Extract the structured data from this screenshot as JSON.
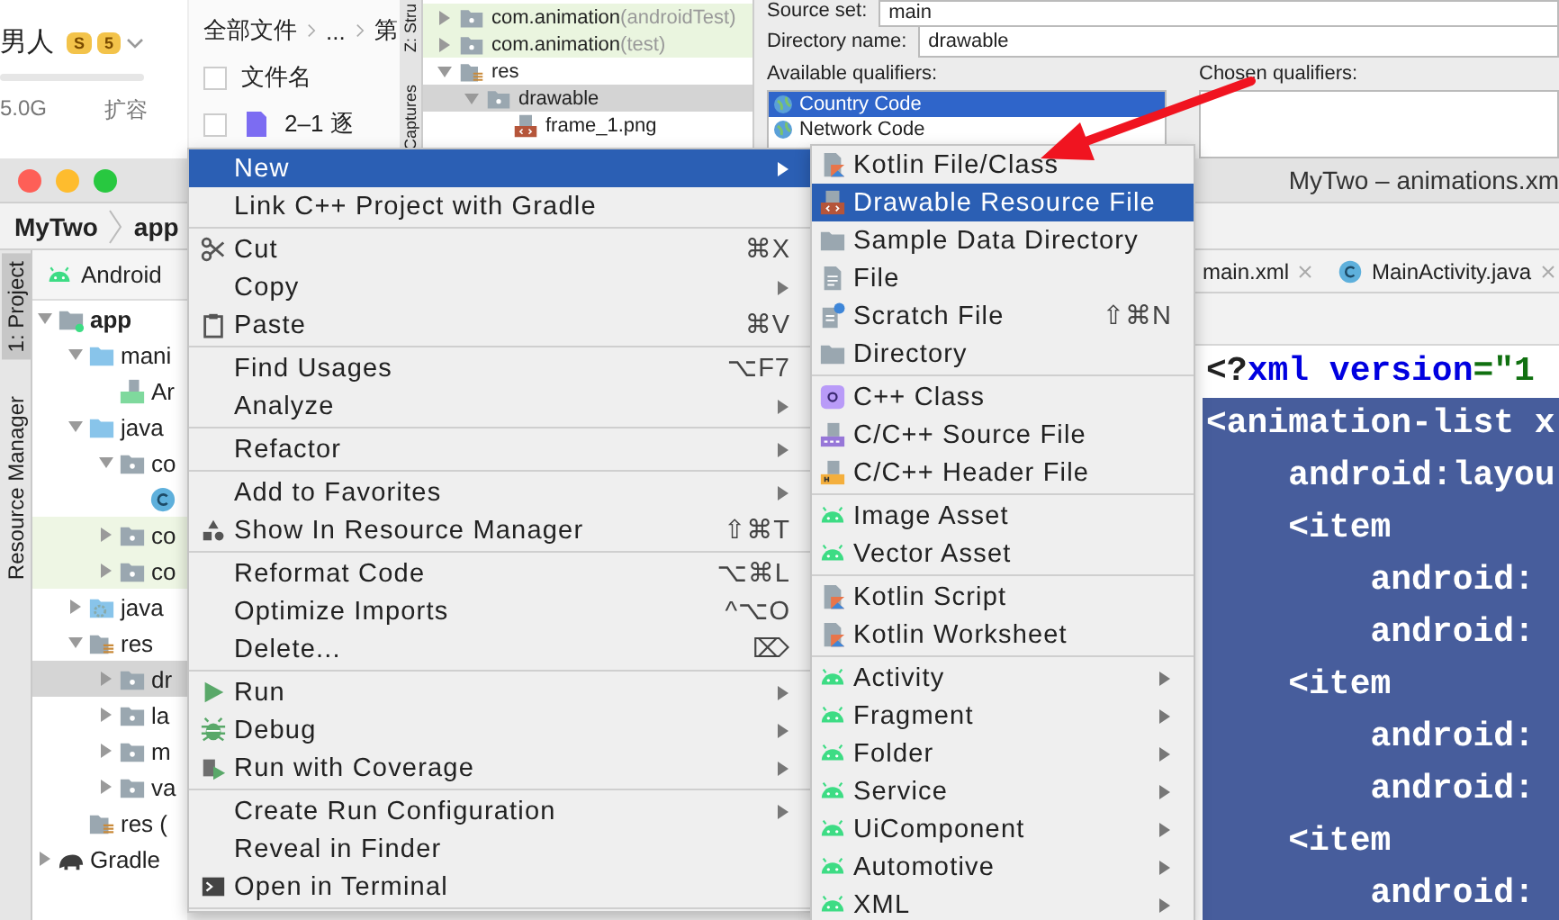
{
  "file_manager": {
    "user_name": "男人",
    "badges": [
      "S",
      "5"
    ],
    "storage": "5.0G",
    "expand_label": "扩容",
    "breadcrumb": [
      "全部文件",
      "...",
      "第"
    ],
    "column_header": "文件名",
    "header_checked": false,
    "rows": [
      {
        "name": "2–1 逐",
        "checked": false
      }
    ]
  },
  "structure_window": {
    "side_tabs": [
      "Z: Stru",
      "Captures"
    ],
    "tree": [
      {
        "label": "com.animation",
        "note": "(androidTest)",
        "expanded": false,
        "selected": false,
        "highlighted": true
      },
      {
        "label": "com.animation",
        "note": "(test)",
        "expanded": false,
        "selected": false,
        "highlighted": true
      },
      {
        "label": "res",
        "expanded": true,
        "selected": false,
        "highlighted": false,
        "children": [
          {
            "label": "drawable",
            "expanded": true,
            "selected": true,
            "children": [
              {
                "label": "frame_1.png",
                "selected": false,
                "highlighted": false
              }
            ]
          }
        ]
      }
    ]
  },
  "new_resource_dialog": {
    "source_set_label": "Source set:",
    "source_set": "main",
    "directory_name_label": "Directory name:",
    "directory_name": "drawable",
    "available_label": "Available qualifiers:",
    "available_qualifiers": [
      {
        "label": "Country Code",
        "selected": true
      },
      {
        "label": "Network Code",
        "selected": false
      }
    ],
    "chosen_label": "Chosen qualifiers:"
  },
  "ide": {
    "window_title": "MyTwo – animations.xm",
    "breadcrumb": [
      "MyTwo",
      "app"
    ],
    "side_tabs": [
      {
        "label": "1: Project",
        "selected": true
      },
      {
        "label": "Resource Manager",
        "selected": false
      }
    ],
    "project_view": "Android",
    "project_tree": [
      {
        "label": "app",
        "expanded": true,
        "selected": false,
        "highlighted": false,
        "children": [
          {
            "label": "mani",
            "expanded": true,
            "selected": false,
            "highlighted": false,
            "children": [
              {
                "label": "Ar",
                "selected": false,
                "highlighted": false
              }
            ]
          },
          {
            "label": "java",
            "expanded": true,
            "selected": false,
            "highlighted": false,
            "children": [
              {
                "label": "co",
                "expanded": true,
                "selected": false,
                "highlighted": false,
                "children": [
                  {
                    "selected": false,
                    "highlighted": false
                  }
                ]
              },
              {
                "label": "co",
                "expanded": false,
                "selected": false,
                "highlighted": true
              },
              {
                "label": "co",
                "expanded": false,
                "selected": false,
                "highlighted": true
              }
            ]
          },
          {
            "label": "java",
            "expanded": false,
            "selected": false,
            "highlighted": false
          },
          {
            "label": "res",
            "expanded": true,
            "selected": false,
            "highlighted": false,
            "children": [
              {
                "label": "dr",
                "expanded": false,
                "selected": true
              },
              {
                "label": "la",
                "expanded": false,
                "selected": false,
                "highlighted": false
              },
              {
                "label": "m",
                "expanded": false,
                "selected": false,
                "highlighted": false
              },
              {
                "label": "va",
                "expanded": false,
                "selected": false,
                "highlighted": false
              }
            ]
          },
          {
            "label": "res (",
            "selected": false,
            "highlighted": false
          }
        ]
      },
      {
        "label": "Gradle",
        "expanded": false,
        "selected": false,
        "highlighted": false
      }
    ],
    "editor_tabs": [
      {
        "label": "main.xml"
      },
      {
        "label": "MainActivity.java"
      }
    ],
    "code_lines": [
      {
        "selected": false,
        "tokens": [
          {
            "text": "<?",
            "kind": "plain"
          },
          {
            "text": "xml version",
            "kind": "keyword"
          },
          {
            "text": "=\"1",
            "kind": "string"
          }
        ]
      },
      {
        "selected": true,
        "tokens": [
          {
            "text": "<animation-list x",
            "kind": "plain"
          }
        ]
      },
      {
        "selected": true,
        "tokens": [
          {
            "text": "    android:layou",
            "kind": "plain"
          }
        ]
      },
      {
        "selected": true,
        "tokens": [
          {
            "text": "    <item",
            "kind": "plain"
          }
        ]
      },
      {
        "selected": true,
        "tokens": [
          {
            "text": "        android:",
            "kind": "plain"
          }
        ]
      },
      {
        "selected": true,
        "tokens": [
          {
            "text": "        android:",
            "kind": "plain"
          }
        ]
      },
      {
        "selected": true,
        "tokens": [
          {
            "text": "    <item",
            "kind": "plain"
          }
        ]
      },
      {
        "selected": true,
        "tokens": [
          {
            "text": "        android:",
            "kind": "plain"
          }
        ]
      },
      {
        "selected": true,
        "tokens": [
          {
            "text": "        android:",
            "kind": "plain"
          }
        ]
      },
      {
        "selected": true,
        "tokens": [
          {
            "text": "    <item",
            "kind": "plain"
          }
        ]
      },
      {
        "selected": true,
        "tokens": [
          {
            "text": "        android:",
            "kind": "plain"
          }
        ]
      }
    ]
  },
  "context_menu": {
    "items": [
      {
        "kind": "item",
        "label": "New",
        "submenu": true,
        "selected": true
      },
      {
        "kind": "item",
        "label": "Link C++ Project with Gradle",
        "submenu": false,
        "selected": false
      },
      {
        "kind": "separator"
      },
      {
        "kind": "item",
        "label": "Cut",
        "shortcut": "⌘X",
        "submenu": false,
        "selected": false
      },
      {
        "kind": "item",
        "label": "Copy",
        "submenu": true,
        "selected": false
      },
      {
        "kind": "item",
        "label": "Paste",
        "shortcut": "⌘V",
        "submenu": false,
        "selected": false
      },
      {
        "kind": "separator"
      },
      {
        "kind": "item",
        "label": "Find Usages",
        "shortcut": "⌥F7",
        "submenu": false,
        "selected": false
      },
      {
        "kind": "item",
        "label": "Analyze",
        "submenu": true,
        "selected": false
      },
      {
        "kind": "separator"
      },
      {
        "kind": "item",
        "label": "Refactor",
        "submenu": true,
        "selected": false
      },
      {
        "kind": "separator"
      },
      {
        "kind": "item",
        "label": "Add to Favorites",
        "submenu": true,
        "selected": false
      },
      {
        "kind": "item",
        "label": "Show In Resource Manager",
        "shortcut": "⇧⌘T",
        "submenu": false,
        "selected": false
      },
      {
        "kind": "separator"
      },
      {
        "kind": "item",
        "label": "Reformat Code",
        "shortcut": "⌥⌘L",
        "submenu": false,
        "selected": false
      },
      {
        "kind": "item",
        "label": "Optimize Imports",
        "shortcut": "^⌥O",
        "submenu": false,
        "selected": false
      },
      {
        "kind": "item",
        "label": "Delete...",
        "shortcut": "⌦",
        "submenu": false,
        "selected": false
      },
      {
        "kind": "separator"
      },
      {
        "kind": "item",
        "label": "Run",
        "submenu": true,
        "selected": false
      },
      {
        "kind": "item",
        "label": "Debug",
        "submenu": true,
        "selected": false
      },
      {
        "kind": "item",
        "label": "Run with Coverage",
        "submenu": true,
        "selected": false
      },
      {
        "kind": "separator"
      },
      {
        "kind": "item",
        "label": "Create Run Configuration",
        "submenu": true,
        "selected": false
      },
      {
        "kind": "item",
        "label": "Reveal in Finder",
        "submenu": false,
        "selected": false
      },
      {
        "kind": "item",
        "label": "Open in Terminal",
        "submenu": false,
        "selected": false
      },
      {
        "kind": "separator"
      }
    ]
  },
  "new_submenu": {
    "items": [
      {
        "kind": "item",
        "label": "Kotlin File/Class",
        "submenu": false,
        "selected": false
      },
      {
        "kind": "item",
        "label": "Drawable Resource File",
        "submenu": false,
        "selected": true
      },
      {
        "kind": "item",
        "label": "Sample Data Directory",
        "submenu": false,
        "selected": false
      },
      {
        "kind": "item",
        "label": "File",
        "submenu": false,
        "selected": false
      },
      {
        "kind": "item",
        "label": "Scratch File",
        "shortcut": "⇧⌘N",
        "submenu": false,
        "selected": false
      },
      {
        "kind": "item",
        "label": "Directory",
        "submenu": false,
        "selected": false
      },
      {
        "kind": "separator"
      },
      {
        "kind": "item",
        "label": "C++ Class",
        "submenu": false,
        "selected": false
      },
      {
        "kind": "item",
        "label": "C/C++ Source File",
        "submenu": false,
        "selected": false
      },
      {
        "kind": "item",
        "label": "C/C++ Header File",
        "submenu": false,
        "selected": false
      },
      {
        "kind": "separator"
      },
      {
        "kind": "item",
        "label": "Image Asset",
        "submenu": false,
        "selected": false
      },
      {
        "kind": "item",
        "label": "Vector Asset",
        "submenu": false,
        "selected": false
      },
      {
        "kind": "separator"
      },
      {
        "kind": "item",
        "label": "Kotlin Script",
        "submenu": false,
        "selected": false
      },
      {
        "kind": "item",
        "label": "Kotlin Worksheet",
        "submenu": false,
        "selected": false
      },
      {
        "kind": "separator"
      },
      {
        "kind": "item",
        "label": "Activity",
        "submenu": true,
        "selected": false
      },
      {
        "kind": "item",
        "label": "Fragment",
        "submenu": true,
        "selected": false
      },
      {
        "kind": "item",
        "label": "Folder",
        "submenu": true,
        "selected": false
      },
      {
        "kind": "item",
        "label": "Service",
        "submenu": true,
        "selected": false
      },
      {
        "kind": "item",
        "label": "UiComponent",
        "submenu": true,
        "selected": false
      },
      {
        "kind": "item",
        "label": "Automotive",
        "submenu": true,
        "selected": false
      },
      {
        "kind": "item",
        "label": "XML",
        "submenu": true,
        "selected": false
      }
    ]
  }
}
